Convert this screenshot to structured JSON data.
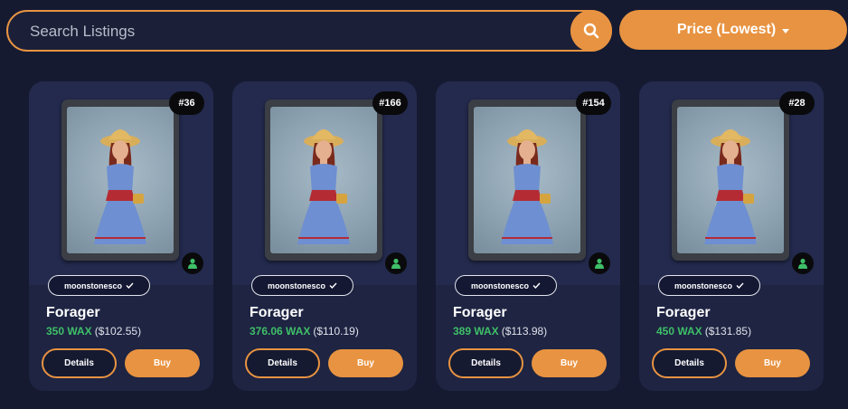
{
  "search": {
    "placeholder": "Search Listings",
    "icon": "search-icon"
  },
  "sort": {
    "label": "Price (Lowest)",
    "icon": "caret-down-icon"
  },
  "colors": {
    "accent": "#e89341",
    "wax": "#3fbf68",
    "background": "#151a31",
    "card": "#1e2442"
  },
  "listings": [
    {
      "number": "#36",
      "collection": "moonstonesco",
      "name": "Forager",
      "price_wax": "350 WAX",
      "price_usd": "($102.55)",
      "details_label": "Details",
      "buy_label": "Buy"
    },
    {
      "number": "#166",
      "collection": "moonstonesco",
      "name": "Forager",
      "price_wax": "376.06 WAX",
      "price_usd": "($110.19)",
      "details_label": "Details",
      "buy_label": "Buy"
    },
    {
      "number": "#154",
      "collection": "moonstonesco",
      "name": "Forager",
      "price_wax": "389 WAX",
      "price_usd": "($113.98)",
      "details_label": "Details",
      "buy_label": "Buy"
    },
    {
      "number": "#28",
      "collection": "moonstonesco",
      "name": "Forager",
      "price_wax": "450 WAX",
      "price_usd": "($131.85)",
      "details_label": "Details",
      "buy_label": "Buy"
    }
  ]
}
